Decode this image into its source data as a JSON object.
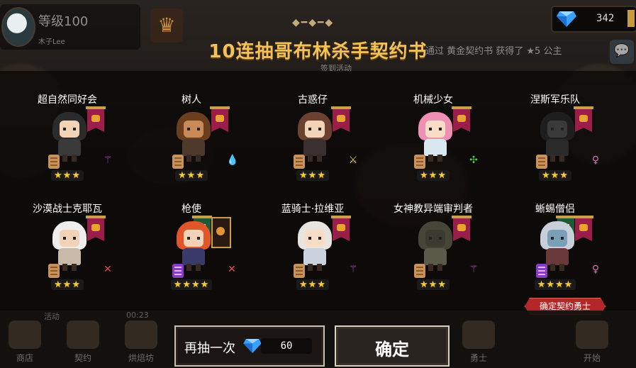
{
  "header": {
    "level": "等级100",
    "username": "木子Lee",
    "gems": "342",
    "title": "10连抽哥布林杀手契约书",
    "ticker": "通过 黄金契约书 获得了 ★5 公主",
    "sign_tab": "签到活动"
  },
  "cards": [
    {
      "name": "超自然同好会",
      "stars": "★★★"
    },
    {
      "name": "树人",
      "stars": "★★★"
    },
    {
      "name": "古惑仔",
      "stars": "★★★"
    },
    {
      "name": "机械少女",
      "stars": "★★★"
    },
    {
      "name": "涅斯军乐队",
      "stars": "★★★"
    },
    {
      "name": "沙漠战士克耶瓦",
      "stars": "★★★"
    },
    {
      "name": "枪使",
      "stars": "★★★★"
    },
    {
      "name": "蓝骑士·拉维亚",
      "stars": "★★★"
    },
    {
      "name": "女神教异端审判者",
      "stars": "★★★"
    },
    {
      "name": "蜥蜴僧侣",
      "stars": "★★★★"
    }
  ],
  "confirm_ribbon": "确定契约勇士",
  "buttons": {
    "redraw_label": "再抽一次",
    "redraw_cost": "60",
    "ok_label": "确定"
  },
  "nav": {
    "tab_activity": "活动",
    "timer": "00:23",
    "items": [
      "商店",
      "契约",
      "烘焙坊",
      "",
      "",
      "",
      "",
      "",
      "勇士",
      "开始"
    ]
  },
  "colors": {
    "title_gold": "#f2c15a",
    "star_yellow": "#f2cc3c",
    "banner_red": "#9b1e4a",
    "ribbon_red": "#b3262a"
  }
}
